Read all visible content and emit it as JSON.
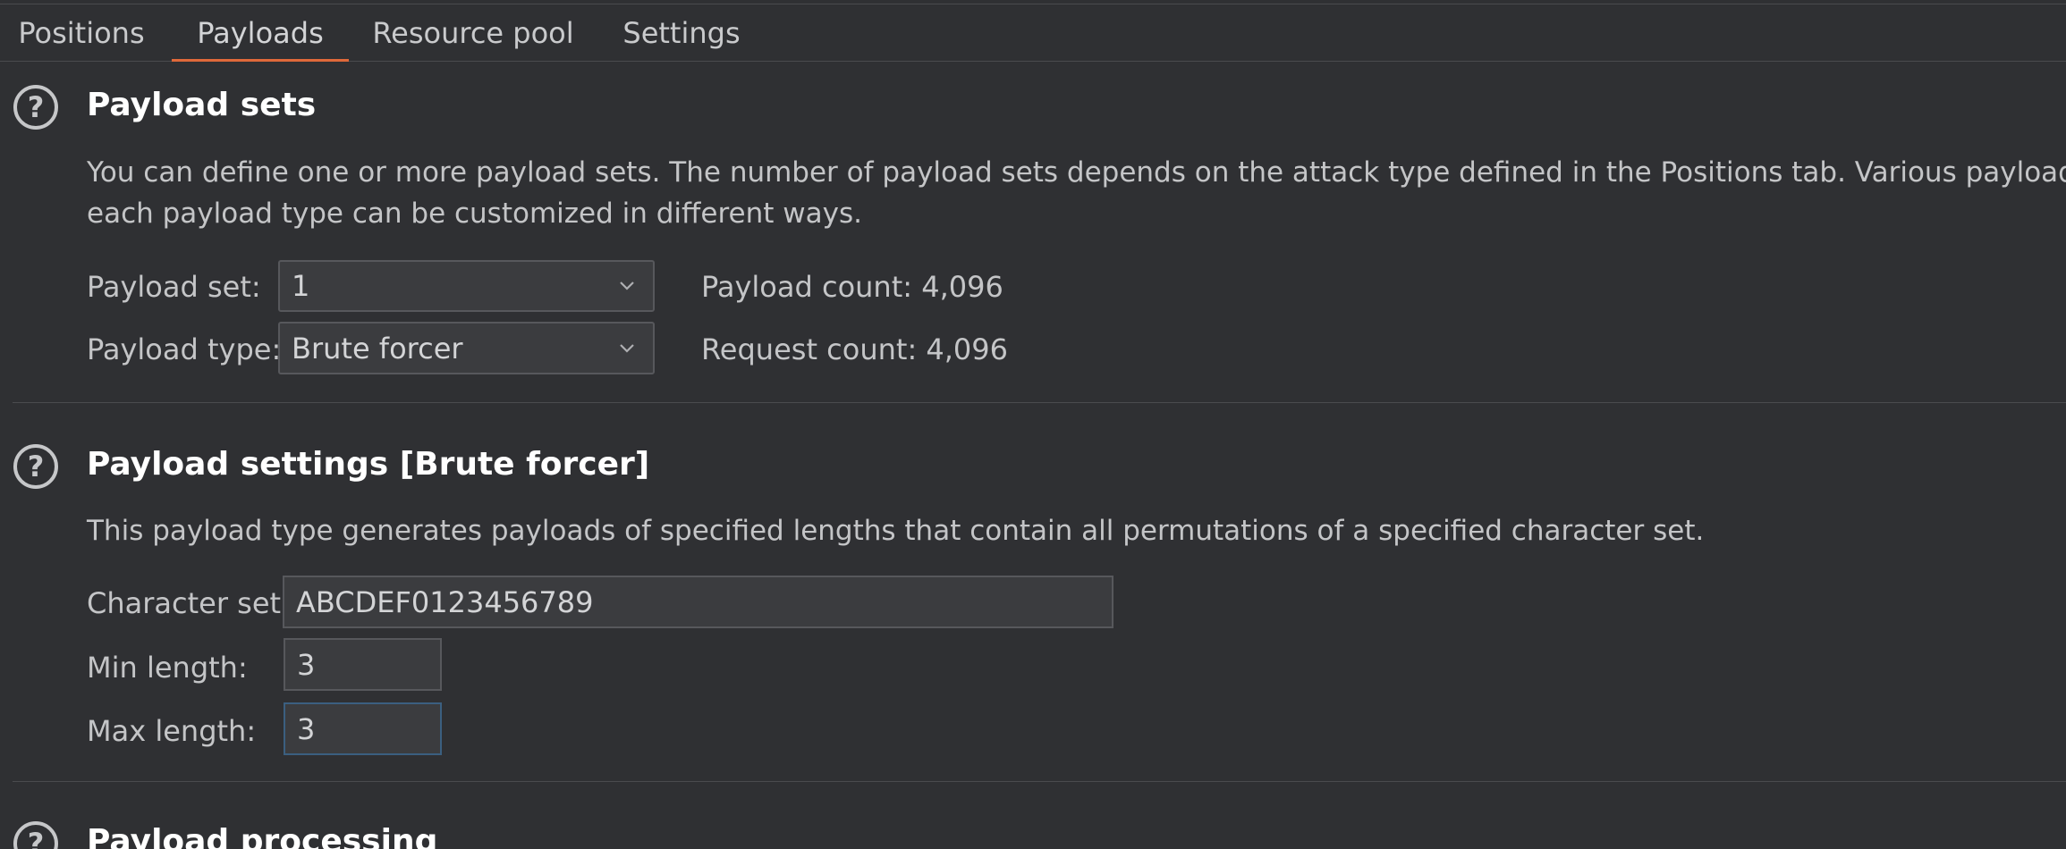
{
  "tabs": [
    {
      "label": "Positions"
    },
    {
      "label": "Payloads"
    },
    {
      "label": "Resource pool"
    },
    {
      "label": "Settings"
    }
  ],
  "payload_sets": {
    "title": "Payload sets",
    "description_line1": "You can define one or more payload sets. The number of payload sets depends on the attack type defined in the Positions tab. Various payload ty",
    "description_line2": "each payload type can be customized in different ways.",
    "set_label": "Payload set:",
    "set_value": "1",
    "type_label": "Payload type:",
    "type_value": "Brute forcer",
    "payload_count": "Payload count: 4,096",
    "request_count": "Request count: 4,096"
  },
  "payload_settings": {
    "title": "Payload settings [Brute forcer]",
    "description": "This payload type generates payloads of specified lengths that contain all permutations of a specified character set.",
    "charset_label": "Character set:",
    "charset_value": "ABCDEF0123456789",
    "min_label": "Min length:",
    "min_value": "3",
    "max_label": "Max length:",
    "max_value": "3"
  },
  "payload_processing": {
    "title": "Payload processing"
  },
  "icons": {
    "help": "?"
  },
  "colors": {
    "background": "#2f3033",
    "accent": "#e0693a",
    "focus_border": "#3b5f80"
  }
}
